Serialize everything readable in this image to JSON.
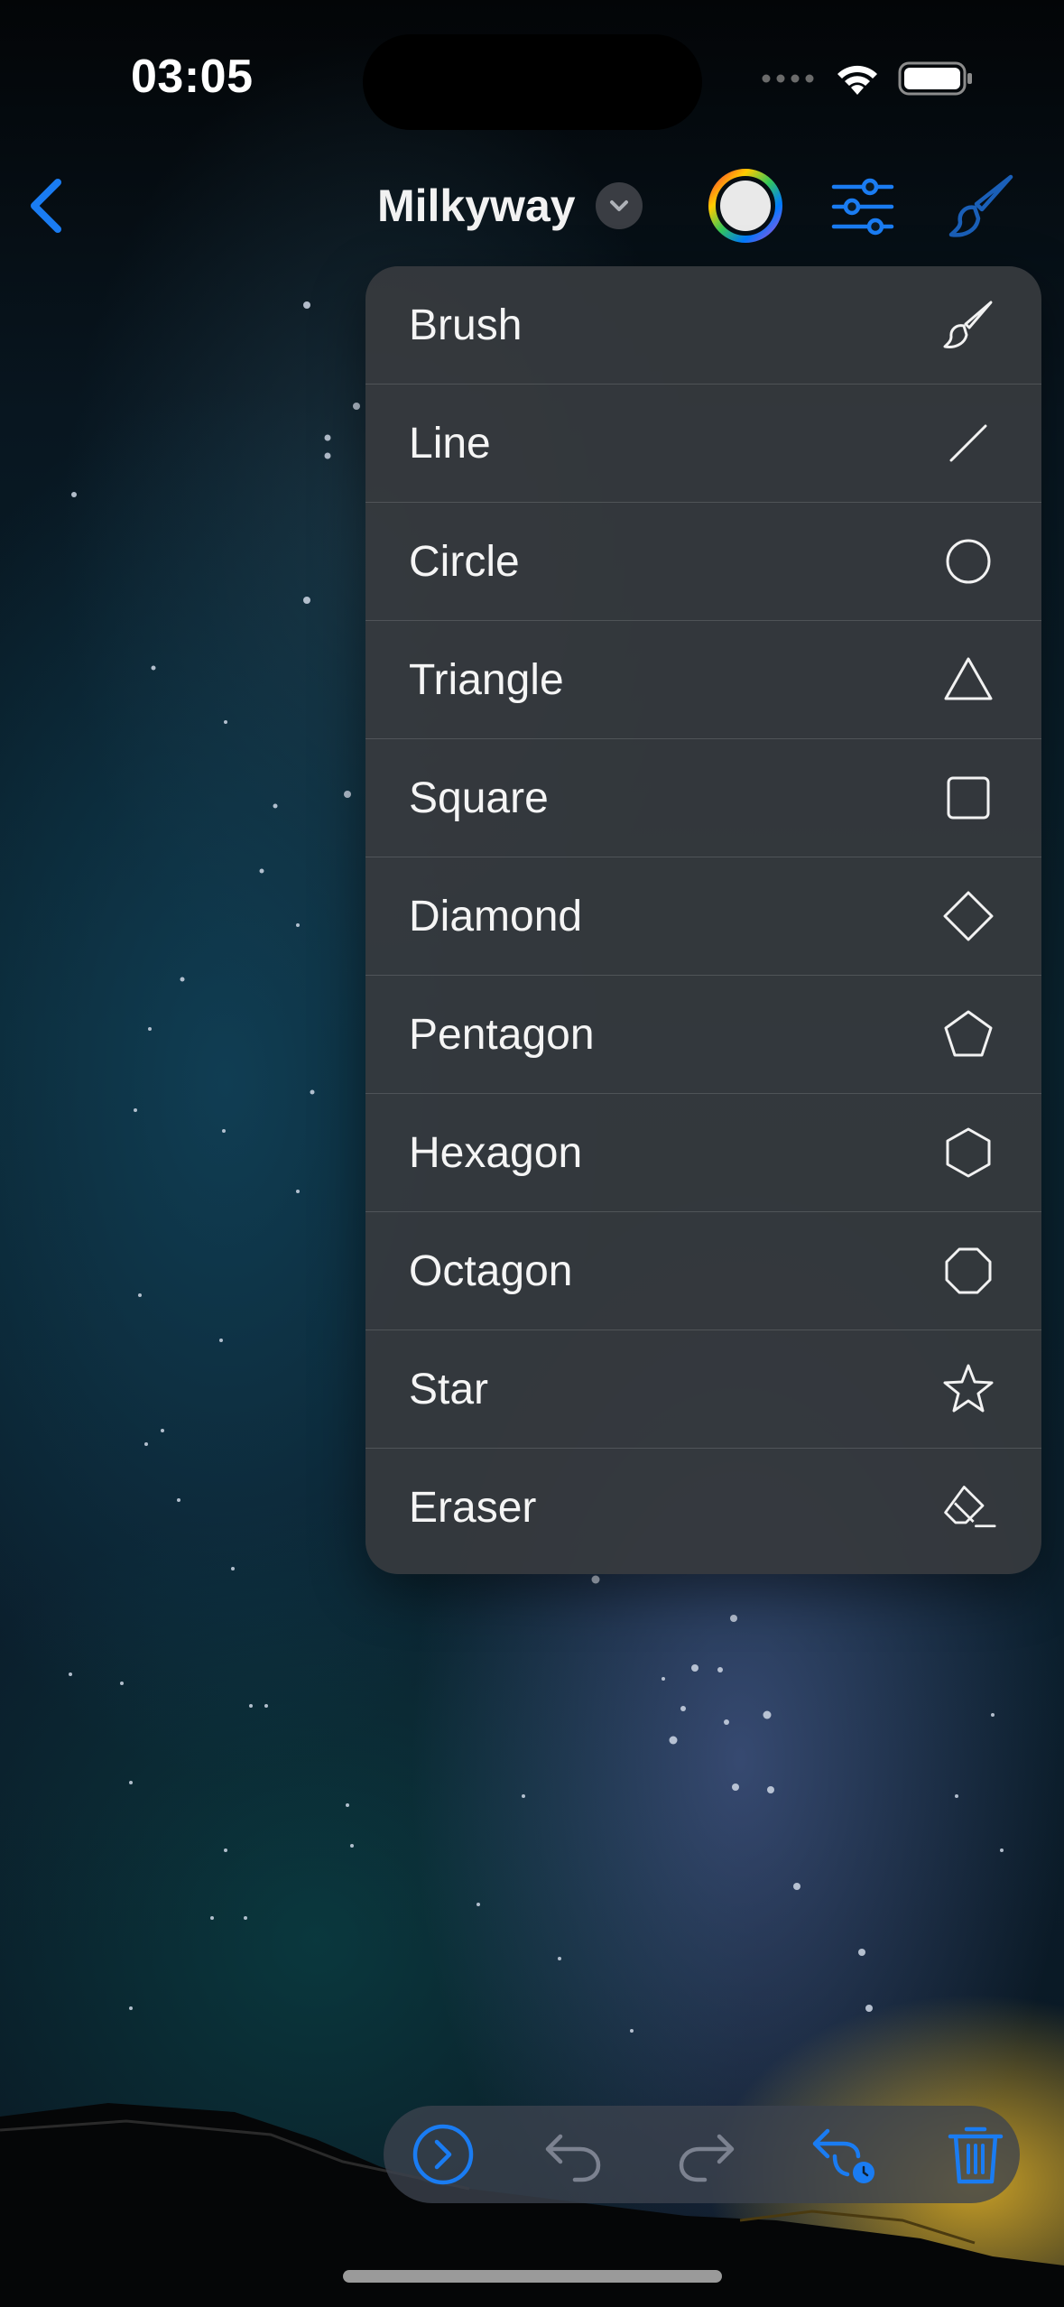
{
  "status_bar": {
    "time": "03:05"
  },
  "nav": {
    "title": "Milkyway",
    "accent_color": "#1a7cf2"
  },
  "menu": {
    "items": [
      {
        "label": "Brush",
        "icon": "brush-icon"
      },
      {
        "label": "Line",
        "icon": "line-icon"
      },
      {
        "label": "Circle",
        "icon": "circle-icon"
      },
      {
        "label": "Triangle",
        "icon": "triangle-icon"
      },
      {
        "label": "Square",
        "icon": "square-icon"
      },
      {
        "label": "Diamond",
        "icon": "diamond-icon"
      },
      {
        "label": "Pentagon",
        "icon": "pentagon-icon"
      },
      {
        "label": "Hexagon",
        "icon": "hexagon-icon"
      },
      {
        "label": "Octagon",
        "icon": "octagon-icon"
      },
      {
        "label": "Star",
        "icon": "star-icon"
      },
      {
        "label": "Eraser",
        "icon": "eraser-icon"
      }
    ]
  },
  "toolbar": {
    "buttons": [
      "next-icon",
      "undo-icon",
      "redo-icon",
      "undo-history-icon",
      "trash-icon"
    ]
  }
}
